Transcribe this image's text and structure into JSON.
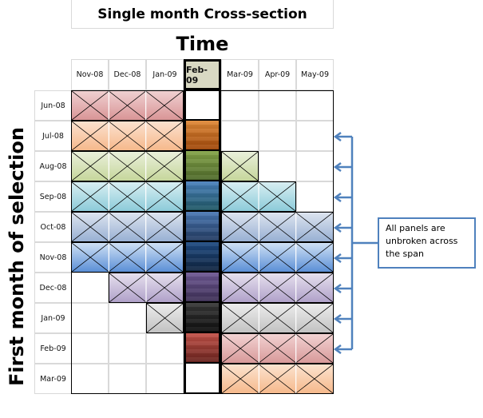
{
  "title": "Single month Cross-section",
  "x_axis_label": "Time",
  "y_axis_label": "First month of selection",
  "columns": [
    "Nov-08",
    "Dec-08",
    "Jan-09",
    "Feb-09",
    "Mar-09",
    "Apr-09",
    "May-09"
  ],
  "selected_column": "Feb-09",
  "rows": [
    {
      "label": "Jun-08",
      "start": "Nov-08",
      "end": "Jan-09",
      "light": [
        "#efd0d1",
        "#d99596"
      ],
      "dark": null
    },
    {
      "label": "Jul-08",
      "start": "Nov-08",
      "end": "Feb-09",
      "light": [
        "#fbe1cf",
        "#f6b98c"
      ],
      "dark": [
        "#e08a38",
        "#a0480a"
      ]
    },
    {
      "label": "Aug-08",
      "start": "Nov-08",
      "end": "Mar-09",
      "light": [
        "#eaf0db",
        "#c6d69b"
      ],
      "dark": [
        "#84a448",
        "#4f6a2b"
      ]
    },
    {
      "label": "Sep-08",
      "start": "Nov-08",
      "end": "Apr-09",
      "light": [
        "#d8eef2",
        "#8ccbd9"
      ],
      "dark": [
        "#4a80bd",
        "#1f5764"
      ]
    },
    {
      "label": "Oct-08",
      "start": "Nov-08",
      "end": "May-09",
      "light": [
        "#dde4ef",
        "#98b0d3"
      ],
      "dark": [
        "#4a78b4",
        "#223a60"
      ]
    },
    {
      "label": "Nov-08",
      "start": "Nov-08",
      "end": "May-09",
      "light": [
        "#cfe0f4",
        "#5b8fd6"
      ],
      "dark": [
        "#1e4a82",
        "#10243f"
      ]
    },
    {
      "label": "Dec-08",
      "start": "Dec-08",
      "end": "May-09",
      "light": [
        "#e6e0ee",
        "#b0a1c9"
      ],
      "dark": [
        "#6e5894",
        "#3d2f55"
      ]
    },
    {
      "label": "Jan-09",
      "start": "Jan-09",
      "end": "May-09",
      "light": [
        "#ececec",
        "#c2c2c2"
      ],
      "dark": [
        "#383838",
        "#0e0e0e"
      ]
    },
    {
      "label": "Feb-09",
      "start": "Feb-09",
      "end": "May-09",
      "light": [
        "#f2d2d2",
        "#d89a9a"
      ],
      "dark": [
        "#c45248",
        "#68221d"
      ]
    },
    {
      "label": "Mar-09",
      "start": "Mar-09",
      "end": "May-09",
      "light": [
        "#fbe3cf",
        "#f6b98c"
      ],
      "dark": null
    }
  ],
  "callout": {
    "text": "All panels are unbroken across the span",
    "points_to_rows": [
      "Jul-08",
      "Aug-08",
      "Sep-08",
      "Oct-08",
      "Nov-08",
      "Dec-08",
      "Jan-09",
      "Feb-09"
    ]
  },
  "colors": {
    "arrow": "#4f81bd",
    "header_selected": "#d9d9c3",
    "grid": "#d9d9d9"
  }
}
